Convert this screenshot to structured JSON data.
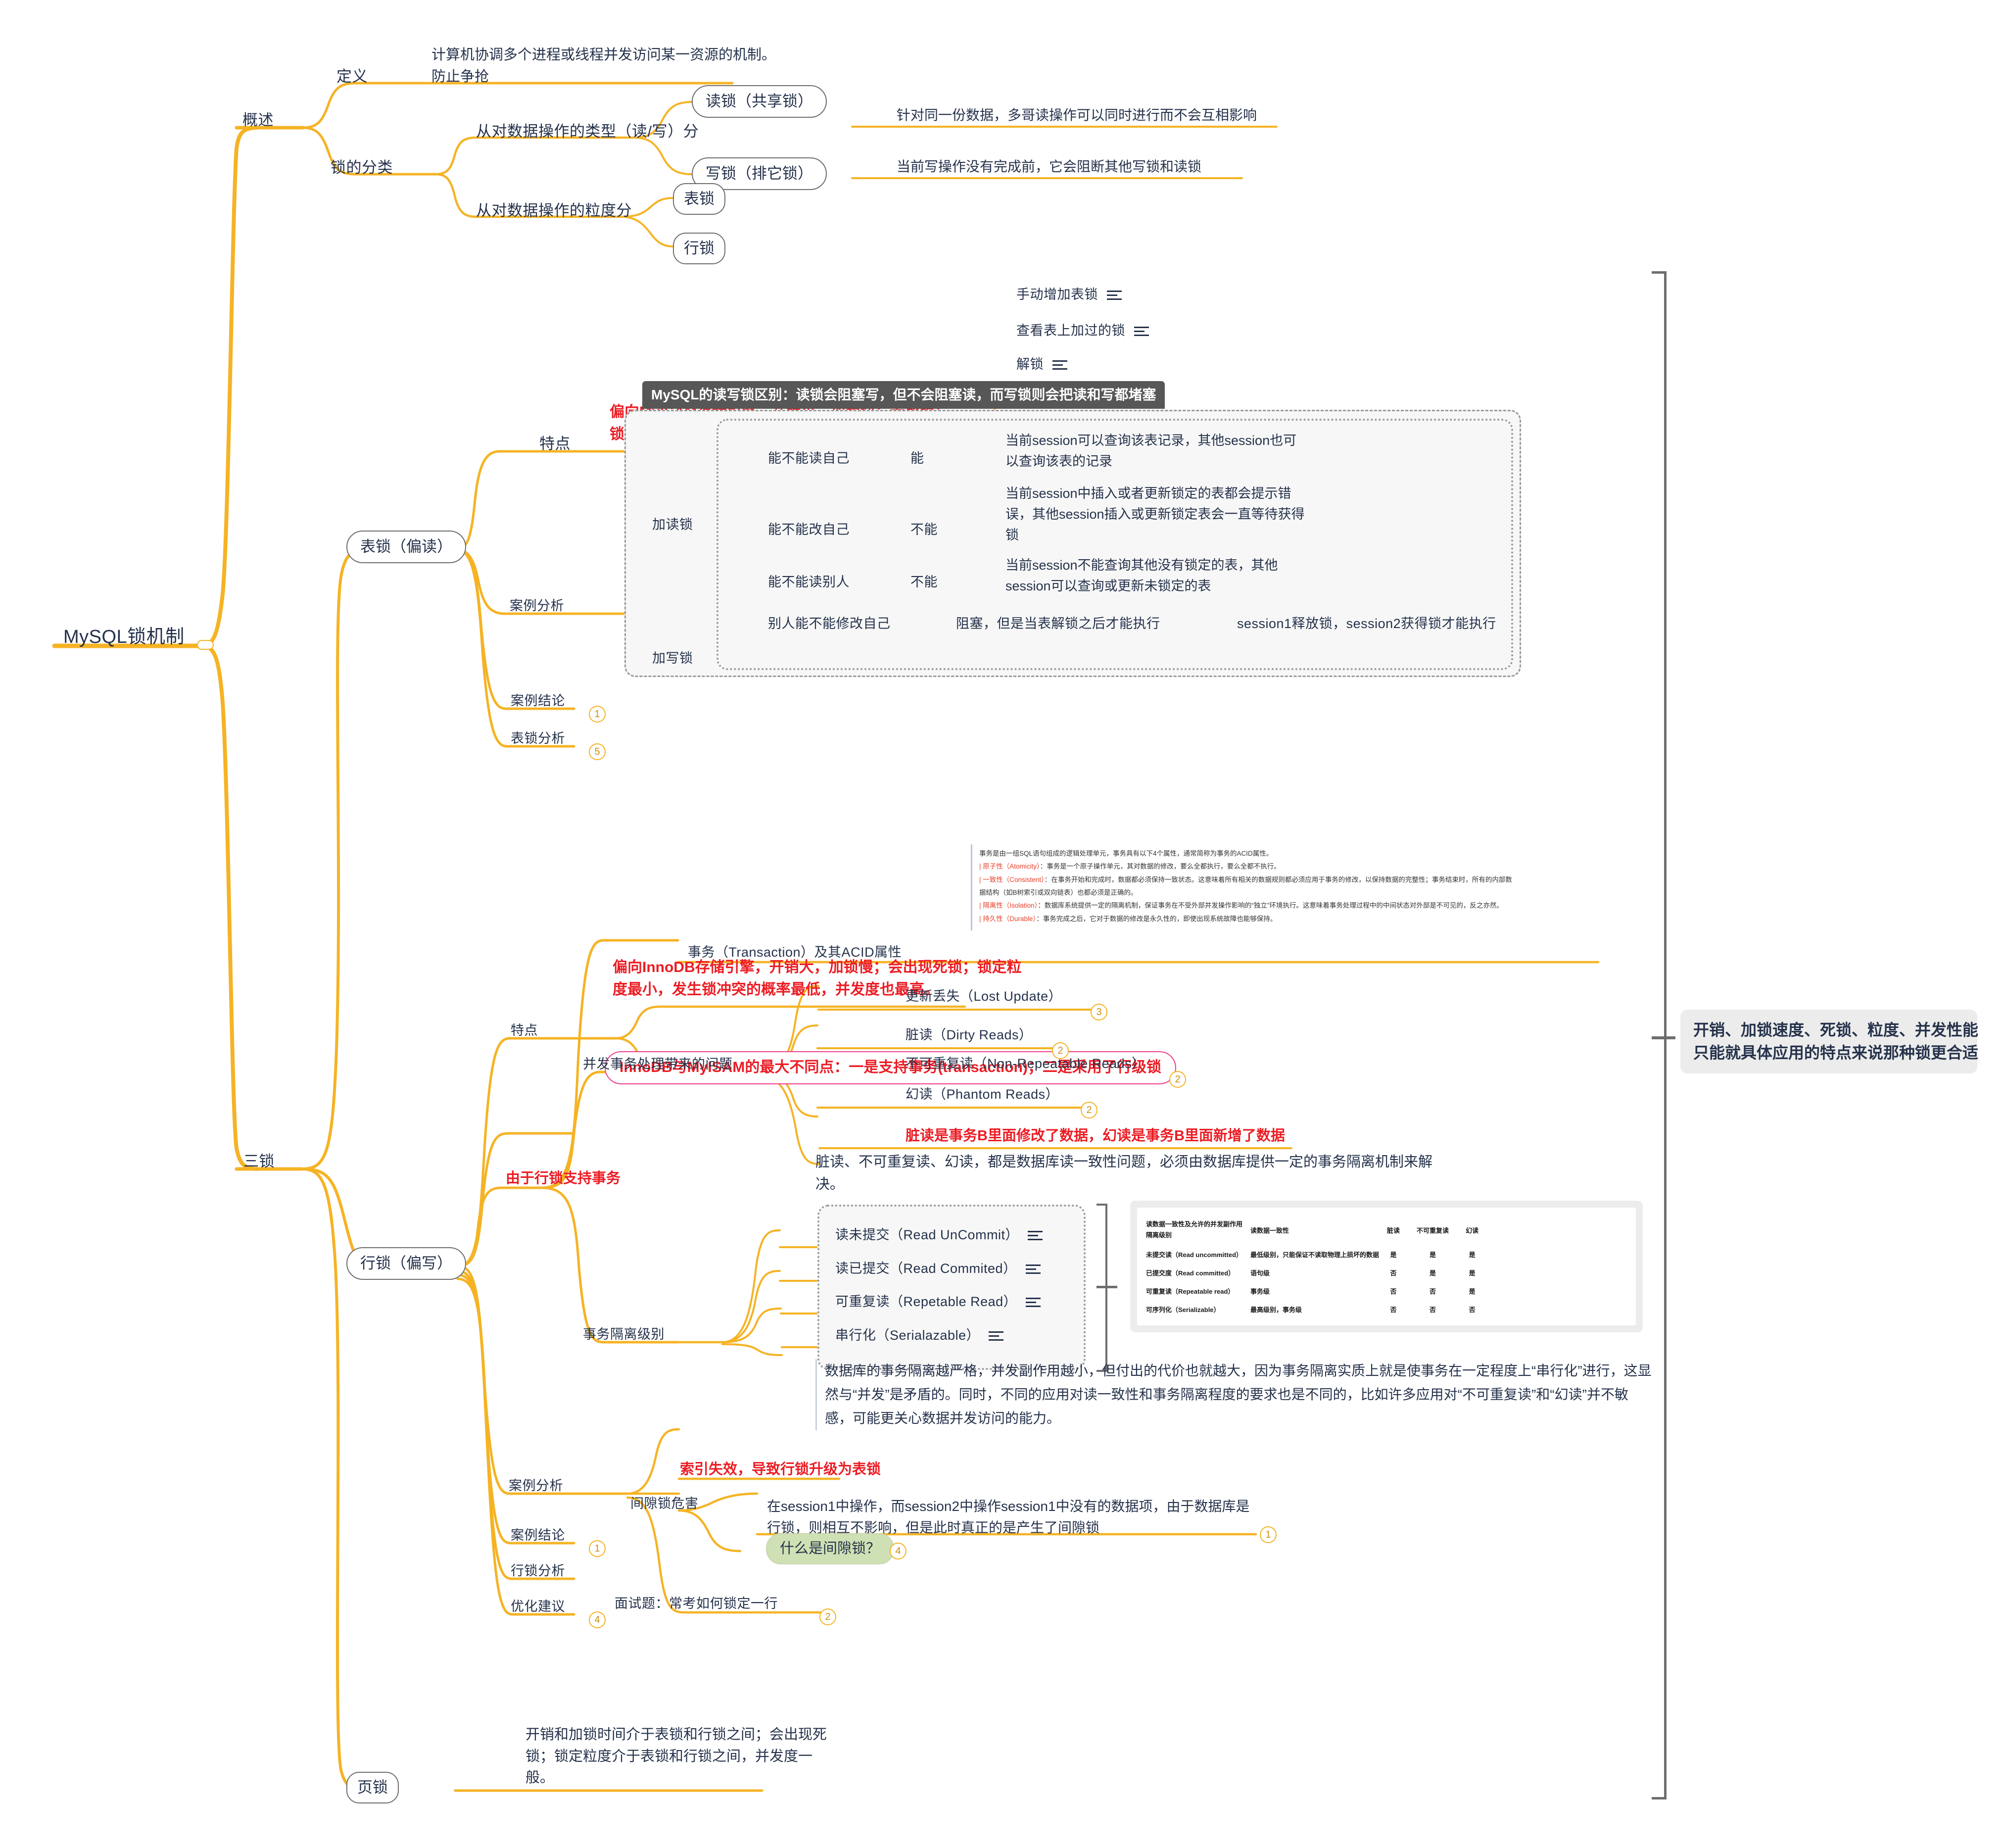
{
  "root": {
    "label": "MySQL锁机制"
  },
  "branches": {
    "overview": {
      "label": "概述"
    },
    "three_locks": {
      "label": "三锁"
    }
  },
  "overview": {
    "definition_label": "定义",
    "definition_text_line1": "计算机协调多个进程或线程并发访问某一资源的机制。",
    "definition_text_line2": "防止争抢",
    "classification_label": "锁的分类",
    "by_type_label": "从对数据操作的类型（读/写）分",
    "read_lock": "读锁（共享锁）",
    "read_lock_desc": "针对同一份数据，多哥读操作可以同时进行而不会互相影响",
    "write_lock": "写锁（排它锁）",
    "write_lock_desc": "当前写操作没有完成前，它会阻断其他写锁和读锁",
    "by_granularity_label": "从对数据操作的粒度分",
    "table_lock": "表锁",
    "row_lock": "行锁"
  },
  "table_lock": {
    "title": "表锁（偏读）",
    "feature_label": "特点",
    "feature_text_line1": "偏向MyISAM存储引擎，开销小，加锁快；无死锁；",
    "feature_text_line2": "锁定粒度大，发生锁冲突的概率最高，并发度最低。",
    "manual_add": "手动增加表锁",
    "view_locks": "查看表上加过的锁",
    "unlock": "解锁",
    "banner": "MySQL的读写锁区别：读锁会阻塞写，但不会阻塞读，而写锁则会把读和写都堵塞",
    "case_analysis_label": "案例分析",
    "read_lock_group": "加读锁",
    "write_lock_group": "加写锁",
    "rows": [
      {
        "question": "能不能读自己",
        "answer": "能",
        "detail": "当前session可以查询该表记录，其他session也可以查询该表的记录",
        "extra": ""
      },
      {
        "question": "能不能改自己",
        "answer": "不能",
        "detail": "当前session中插入或者更新锁定的表都会提示错误，其他session插入或更新锁定表会一直等待获得锁",
        "extra": ""
      },
      {
        "question": "能不能读别人",
        "answer": "不能",
        "detail": "当前session不能查询其他没有锁定的表，其他session可以查询或更新未锁定的表",
        "extra": ""
      },
      {
        "question": "别人能不能修改自己",
        "answer": "阻塞，但是当表解锁之后才能执行",
        "detail": "session1释放锁，session2获得锁才能执行",
        "extra": ""
      }
    ],
    "case_conclusion": "案例结论",
    "case_conclusion_badge": "1",
    "table_lock_analysis": "表锁分析",
    "table_lock_analysis_badge": "5"
  },
  "row_lock": {
    "title": "行锁（偏写）",
    "feature_label": "特点",
    "feature_text_line1": "偏向InnoDB存储引擎，开销大，加锁慢；会出现死锁；锁定粒",
    "feature_text_line2": "度最小，发生锁冲突的概率最低，并发度也最高。",
    "pink_note": "InnoDB与MyISAM的最大不同点：一是支持事务(transaction)；二是采用了行级锁",
    "supports_tx": "由于行锁支持事务",
    "transaction_acid_label": "事务（Transaction）及其ACID属性",
    "acid": {
      "intro": "事务是由一组SQL语句组成的逻辑处理单元，事务具有以下4个属性，通常简称为事务的ACID属性。",
      "items": [
        {
          "key": "原子性（Atomicity）",
          "text": "：事务是一个原子操作单元，其对数据的修改，要么全都执行，要么全都不执行。"
        },
        {
          "key": "一致性（Consistent）",
          "text": "：在事务开始和完成时，数据都必须保持一致状态。这意味着所有相关的数据规则都必须应用于事务的修改，以保持数据的完整性；事务结束时，所有的内部数据结构（如B树索引或双向链表）也都必须是正确的。"
        },
        {
          "key": "隔离性（Isolation）",
          "text": "：数据库系统提供一定的隔离机制，保证事务在不受外部并发操作影响的“独立”环境执行。这意味着事务处理过程中的中间状态对外部是不可见的，反之亦然。"
        },
        {
          "key": "持久性（Durable）",
          "text": "：事务完成之后，它对于数据的修改是永久性的，即使出现系统故障也能够保持。"
        }
      ]
    },
    "concurrency_problems_label": "并发事务处理带来的问题",
    "problems": [
      {
        "label": "更新丢失（Lost Update）",
        "badge": "3"
      },
      {
        "label": "脏读（Dirty Reads）",
        "badge": "2"
      },
      {
        "label": "不可重复读（Non-Repeatable Reads）",
        "badge": "2"
      },
      {
        "label": "幻读（Phantom Reads）",
        "badge": "2"
      }
    ],
    "problems_red_note": "脏读是事务B里面修改了数据，幻读是事务B里面新增了数据",
    "consistency_note": "脏读、不可重复读、幻读，都是数据库读一致性问题，必须由数据库提供一定的事务隔离机制来解决。",
    "isolation_levels_label": "事务隔离级别",
    "isolation_levels": [
      "读未提交（Read UnCommit）",
      "读已提交（Read Commited）",
      "可重复读（Repetable Read）",
      "串行化（Serialazable）"
    ],
    "isolation_table": {
      "header": [
        "读数据一致性及允许的并发副作用\n隔离级别",
        "读数据一致性",
        "脏读",
        "不可重复读",
        "幻读"
      ],
      "header_col1_line1": "读数据一致性及允许的并发副作用",
      "header_col1_line2": "隔离级别",
      "header_col2": "读数据一致性",
      "header_col3": "脏读",
      "header_col4": "不可重复读",
      "header_col5": "幻读",
      "rows": [
        {
          "level": "未提交读（Read uncommitted）",
          "consistency": "最低级别，只能保证不读取物理上损坏的数据",
          "dirty": "是",
          "nonrepeat": "是",
          "phantom": "是"
        },
        {
          "level": "已提交度（Read committed）",
          "consistency": "语句级",
          "dirty": "否",
          "nonrepeat": "是",
          "phantom": "是"
        },
        {
          "level": "可重复读（Repeatable read）",
          "consistency": "事务级",
          "dirty": "否",
          "nonrepeat": "否",
          "phantom": "是"
        },
        {
          "level": "可序列化（Serializable）",
          "consistency": "最高级别，事务级",
          "dirty": "否",
          "nonrepeat": "否",
          "phantom": "否"
        }
      ]
    },
    "isolation_note": "数据库的事务隔离越严格，并发副作用越小，但付出的代价也就越大，因为事务隔离实质上就是使事务在一定程度上“串行化”进行，这显然与“并发”是矛盾的。同时，不同的应用对读一致性和事务隔离程度的要求也是不同的，比如许多应用对“不可重复读”和“幻读”并不敏感，可能更关心数据并发访问的能力。",
    "case_analysis_label": "案例分析",
    "index_fail_note": "索引失效，导致行锁升级为表锁",
    "gap_lock_harm_label": "间隙锁危害",
    "gap_lock_desc": "在session1中操作，而session2中操作session1中没有的数据项，由于数据库是行锁，则相互不影响，但是此时真正的是产生了间隙锁",
    "gap_lock_desc_badge": "1",
    "what_is_gap_lock": "什么是间隙锁？",
    "what_is_gap_lock_badge": "4",
    "interview_question": "面试题：常考如何锁定一行",
    "interview_question_badge": "2",
    "case_conclusion": "案例结论",
    "case_conclusion_badge": "1",
    "row_lock_analysis": "行锁分析",
    "optimization_advice": "优化建议",
    "optimization_advice_badge": "4"
  },
  "page_lock": {
    "title": "页锁",
    "desc_line1": "开销和加锁时间介于表锁和行锁之间；会出现死",
    "desc_line2": "锁；锁定粒度介于表锁和行锁之间，并发度一",
    "desc_line3": "般。"
  },
  "summary": {
    "line1": "开销、加锁速度、死锁、粒度、并发性能",
    "line2": "只能就具体应用的特点来说那种锁更合适"
  },
  "colors": {
    "branch": "#f5b324",
    "branch_light": "#f8c95a",
    "text": "#25324b",
    "red": "#ec1c24",
    "pink": "#ef3f8f",
    "dark": "#575757",
    "green": "#cfe0b4"
  }
}
